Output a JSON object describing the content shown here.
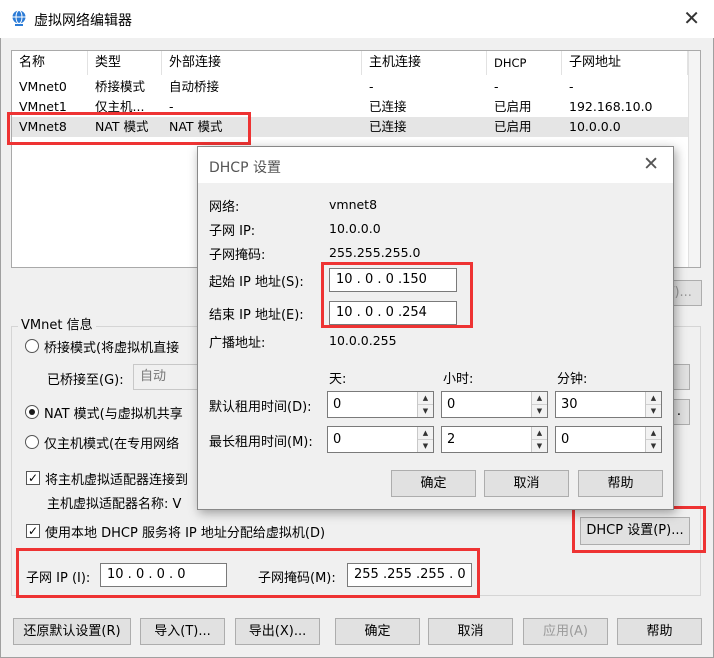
{
  "window": {
    "title": "虚拟网络编辑器",
    "close_glyph": "✕"
  },
  "table": {
    "headers": [
      "名称",
      "类型",
      "外部连接",
      "主机连接",
      "DHCP",
      "子网地址"
    ],
    "rows": [
      [
        "VMnet0",
        "桥接模式",
        "自动桥接",
        "-",
        "-",
        "-"
      ],
      [
        "VMnet1",
        "仅主机...",
        "-",
        "已连接",
        "已启用",
        "192.168.10.0"
      ],
      [
        "VMnet8",
        "NAT 模式",
        "NAT 模式",
        "已连接",
        "已启用",
        "10.0.0.0"
      ]
    ]
  },
  "vmnet_info": {
    "group_label": "VMnet 信息",
    "bridged_label": "桥接模式(将虚拟机直接",
    "bridged_to_label": "已桥接至(G):",
    "bridged_to_value": "自动",
    "nat_label": "NAT 模式(与虚拟机共享",
    "hostonly_label": "仅主机模式(在专用网络",
    "connect_adapter_label": "将主机虚拟适配器连接到",
    "adapter_name_label": "主机虚拟适配器名称: V",
    "dhcp_service_label": "使用本地 DHCP 服务将 IP 地址分配给虚拟机(D)",
    "dhcp_settings_button": "DHCP 设置(P)...",
    "subnet_ip_label": "子网 IP (I):",
    "subnet_ip_value": "10 .  0 .  0 .  0",
    "subnet_mask_label": "子网掩码(M):",
    "subnet_mask_value": "255 .255 .255 .  0",
    "partial_button_text": "/)...",
    "partial_nat_btn": "."
  },
  "bottom_buttons": {
    "restore": "还原默认设置(R)",
    "import": "导入(T)...",
    "export": "导出(X)...",
    "ok": "确定",
    "cancel": "取消",
    "apply": "应用(A)",
    "help": "帮助"
  },
  "dhcp_dialog": {
    "title": "DHCP 设置",
    "close_glyph": "✕",
    "network_label": "网络:",
    "network_value": "vmnet8",
    "subnet_ip_label": "子网 IP:",
    "subnet_ip_value": "10.0.0.0",
    "subnet_mask_label": "子网掩码:",
    "subnet_mask_value": "255.255.255.0",
    "start_ip_label": "起始 IP 地址(S):",
    "start_ip_value": "10  .  0  .  0  .150",
    "end_ip_label": "结束 IP 地址(E):",
    "end_ip_value": "10  .  0  .  0  .254",
    "broadcast_label": "广播地址:",
    "broadcast_value": "10.0.0.255",
    "col_days": "天:",
    "col_hours": "小时:",
    "col_minutes": "分钟:",
    "default_lease_label": "默认租用时间(D):",
    "default_lease": {
      "days": "0",
      "hours": "0",
      "minutes": "30"
    },
    "max_lease_label": "最长租用时间(M):",
    "max_lease": {
      "days": "0",
      "hours": "2",
      "minutes": "0"
    },
    "ok": "确定",
    "cancel": "取消",
    "help": "帮助"
  },
  "colors": {
    "highlight_red": "#ee3333",
    "selected_row": "#e5e5e5"
  }
}
